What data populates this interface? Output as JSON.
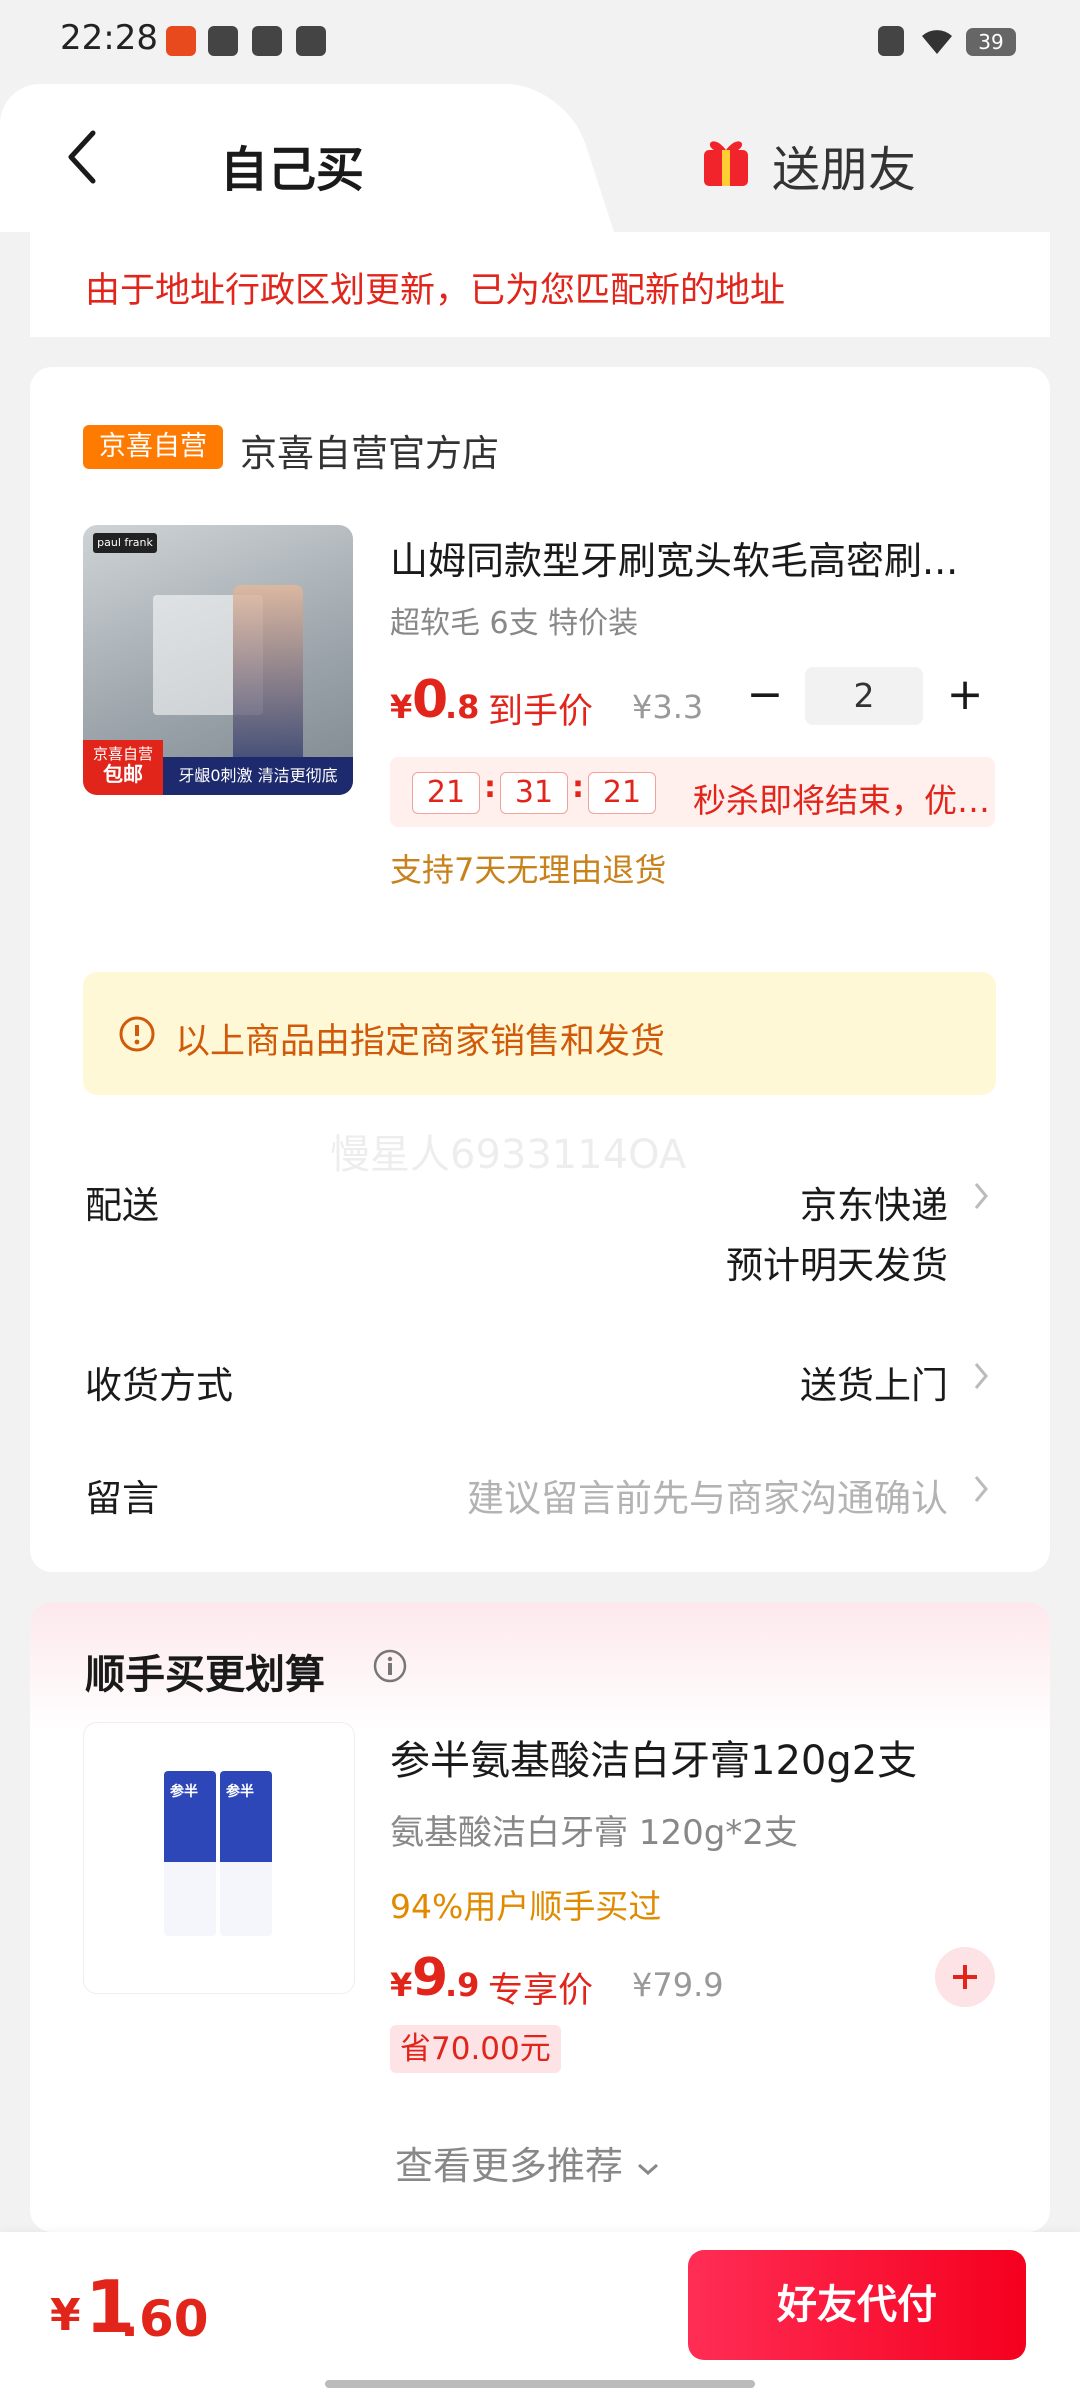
{
  "status_bar": {
    "time": "22:28",
    "battery": "39"
  },
  "tabs": {
    "self_buy": "自己买",
    "send_friend": "送朋友"
  },
  "notice": "由于地址行政区划更新，已为您匹配新的地址",
  "store": {
    "badge": "京喜自营",
    "name": "京喜自营官方店"
  },
  "product": {
    "title": "山姆同款型牙刷宽头软毛高密刷...",
    "spec": "超软毛 6支 特价装",
    "price_symbol": "¥",
    "price_int": "0",
    "price_dec": ".8",
    "price_label": "到手价",
    "original_price": "¥3.3",
    "quantity": "2",
    "image_badge_top": "京喜自营",
    "image_badge_bottom": "包邮",
    "image_caption": "牙龈0刺激  清洁更彻底",
    "image_brand": "paul frank"
  },
  "countdown": {
    "h": "21",
    "m": "31",
    "s": "21",
    "text": "秒杀即将结束，优惠即将失效"
  },
  "return_policy": "支持7天无理由退货",
  "merchant_note": "以上商品由指定商家销售和发货",
  "watermark": "慢星人6933114OA",
  "delivery": {
    "label": "配送",
    "value1": "京东快递",
    "value2": "预计明天发货"
  },
  "receive": {
    "label": "收货方式",
    "value": "送货上门"
  },
  "memo": {
    "label": "留言",
    "placeholder": "建议留言前先与商家沟通确认"
  },
  "recommend": {
    "section_title": "顺手买更划算",
    "title": "参半氨基酸洁白牙膏120g2支",
    "spec": "氨基酸洁白牙膏 120g*2支",
    "bought": "94%用户顺手买过",
    "price_symbol": "¥",
    "price_int": "9",
    "price_dec": ".9",
    "price_label": "专享价",
    "original_price": "¥79.9",
    "save": "省70.00元",
    "image_brand": "参半",
    "more": "查看更多推荐"
  },
  "bottom": {
    "total_symbol": "¥",
    "total_int": "1",
    "total_dec": ".60",
    "pay_button": "好友代付"
  },
  "colors": {
    "brand_red": "#e1251b",
    "orange": "#ff7a00",
    "note_bg": "#fff8d6"
  }
}
